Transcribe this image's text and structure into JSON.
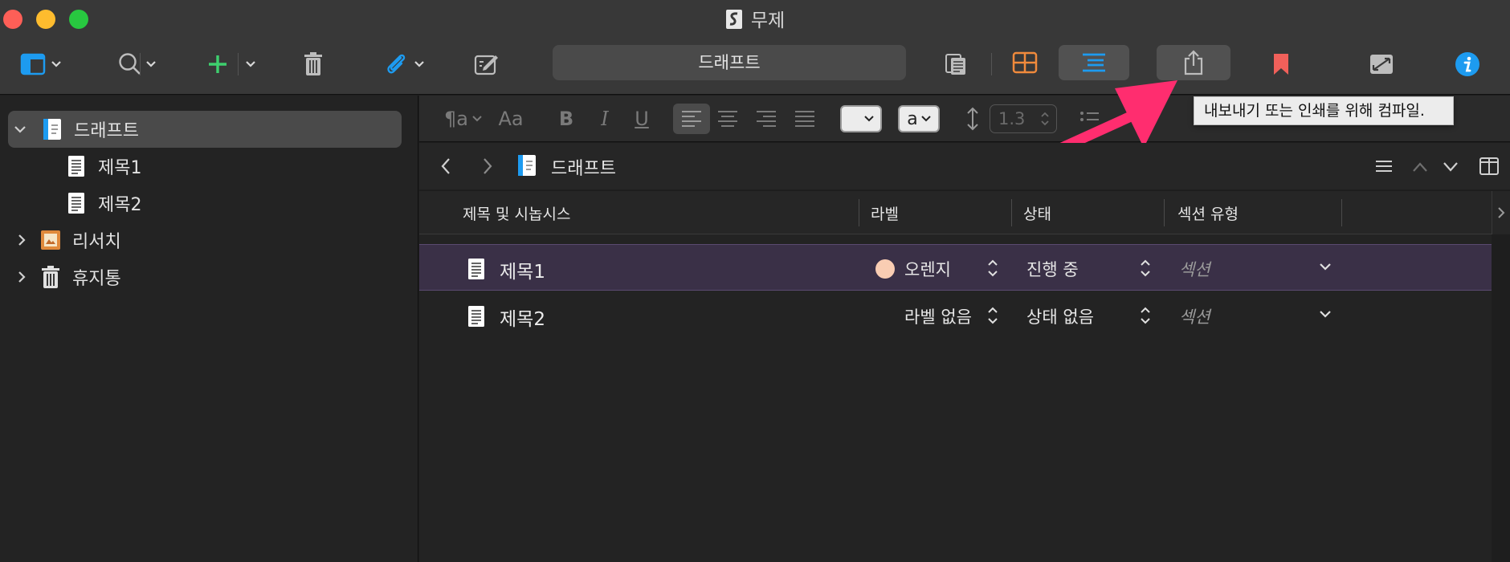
{
  "window": {
    "title": "무제"
  },
  "toolbar": {
    "draft_field": "드래프트",
    "tooltip": "내보내기 또는 인쇄를 위해 컴파일."
  },
  "sidebar": {
    "items": [
      {
        "label": "드래프트",
        "icon": "draft-folder-icon",
        "expanded": true,
        "selected": true
      },
      {
        "label": "제목1",
        "icon": "document-icon"
      },
      {
        "label": "제목2",
        "icon": "document-icon"
      },
      {
        "label": "리서치",
        "icon": "research-folder-icon",
        "expanded": false
      },
      {
        "label": "휴지통",
        "icon": "trash-icon",
        "expanded": false
      }
    ]
  },
  "format_bar": {
    "paragraph": "¶a",
    "font_size": "Aa",
    "bold": "B",
    "italic": "I",
    "underline": "U",
    "highlight_popup": "a",
    "line_spacing": "1.3"
  },
  "editor_nav": {
    "title": "드래프트"
  },
  "outline": {
    "columns": [
      "제목 및 시놉시스",
      "라벨",
      "상태",
      "섹션 유형"
    ],
    "rows": [
      {
        "title": "제목1",
        "label": "오렌지",
        "label_color": "#f9cdb3",
        "status": "진행 중",
        "section": "섹션",
        "selected": true
      },
      {
        "title": "제목2",
        "label": "라벨 없음",
        "status": "상태 없음",
        "section": "섹션",
        "selected": false
      }
    ]
  },
  "colors": {
    "accent_blue": "#1d9bf0",
    "add_green": "#3ecf6e",
    "bookmark_red": "#f0605a",
    "corkboard_orange": "#f08a3c",
    "annotation_arrow": "#ff2d6f"
  }
}
